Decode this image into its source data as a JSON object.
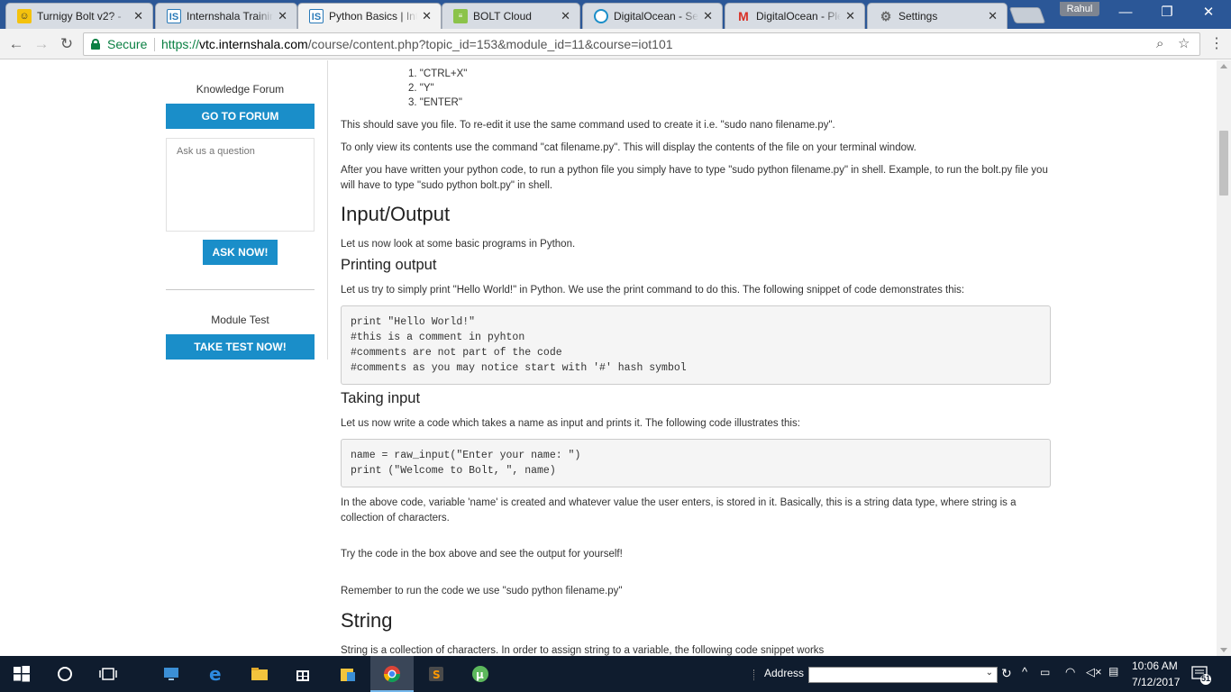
{
  "browser": {
    "tabs": [
      {
        "title": "Turnigy Bolt v2? - ",
        "icon": "bolt-robot-icon",
        "active": false
      },
      {
        "title": "Internshala Trainin",
        "icon": "internshala-icon",
        "active": false
      },
      {
        "title": "Python Basics | Int",
        "icon": "internshala-icon",
        "active": true
      },
      {
        "title": "BOLT Cloud",
        "icon": "bolt-cloud-icon",
        "active": false
      },
      {
        "title": "DigitalOcean - Set",
        "icon": "digitalocean-icon",
        "active": false
      },
      {
        "title": "DigitalOcean - Ple",
        "icon": "gmail-icon",
        "active": false
      },
      {
        "title": "Settings",
        "icon": "gear-icon",
        "active": false
      }
    ],
    "profile_name": "Rahul",
    "secure_label": "Secure",
    "url_scheme": "https://",
    "url_host": "vtc.internshala.com",
    "url_path": "/course/content.php?topic_id=153&module_id=11&course=iot101"
  },
  "sidebar": {
    "forum_heading": "Knowledge Forum",
    "forum_button": "GO TO FORUM",
    "ask_placeholder": "Ask us a question",
    "ask_button": "ASK NOW!",
    "test_heading": "Module Test",
    "test_button": "TAKE TEST NOW!"
  },
  "content": {
    "list_items": [
      "\"CTRL+X\"",
      "\"Y\"",
      "\"ENTER\""
    ],
    "para_save": "This should save you file. To re-edit it use the same command used to create it i.e. \"sudo nano filename.py\".",
    "para_view": "To only view its contents use the command \"cat filename.py\". This will display the contents of the file on your terminal window.",
    "para_run": "After you have written your python code, to run a python file you simply have to type \"sudo python filename.py\" in shell. Example, to run the bolt.py file you will have to type \"sudo python bolt.py\" in shell.",
    "h_io": "Input/Output",
    "para_io": "Let us now look at some basic programs in Python.",
    "h_print": "Printing output",
    "para_print": "Let us try to simply print \"Hello World!\" in Python. We use the print command to do this. The following snippet of code demonstrates this:",
    "code_print": [
      "print \"Hello World!\"",
      "#this is a comment in pyhton",
      "#comments are not part of the code",
      "#comments as you may notice start with '#' hash symbol"
    ],
    "h_input": "Taking input",
    "para_input": "Let us now write a code which takes a name as input and prints it. The following code illustrates this:",
    "code_input": [
      "name = raw_input(\"Enter your name: \")",
      "print (\"Welcome to Bolt, \", name)"
    ],
    "para_explain": "In the above code, variable 'name' is created and whatever value the user enters, is stored in it. Basically, this is a string data type, where string is a collection of characters.",
    "para_try": "Try the code in the box above and see the output for yourself!",
    "para_remember": "Remember to run the code we use \"sudo python filename.py\"",
    "h_string": "String",
    "para_string": "String is a collection of characters. In order to assign string to a variable, the following code snippet works"
  },
  "taskbar": {
    "address_label": "Address",
    "time": "10:06 AM",
    "date": "7/12/2017",
    "notification_count": "51"
  },
  "colors": {
    "accent": "#1a8ec9",
    "secure_green": "#0b8043",
    "taskbar": "#0f1c2e",
    "titlebar": "#2b5797"
  }
}
